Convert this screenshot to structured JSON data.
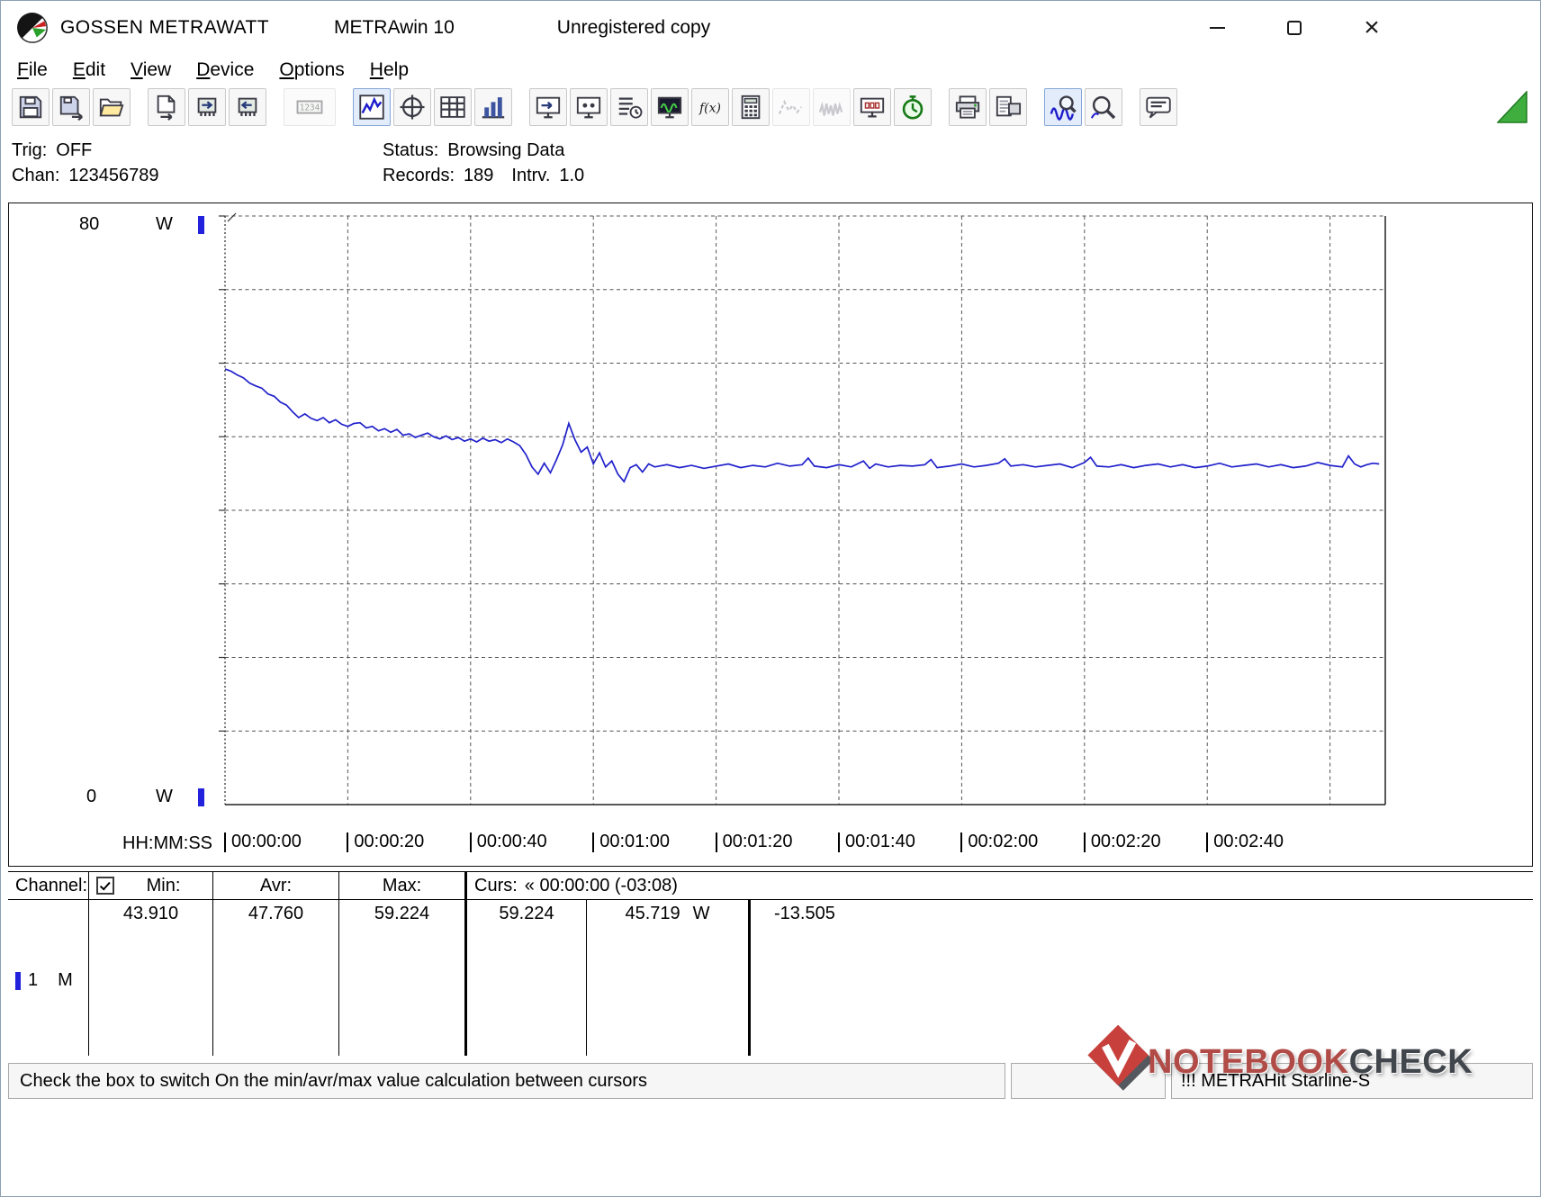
{
  "window": {
    "title_brand": "GOSSEN METRAWATT",
    "title_app": "METRAwin 10",
    "title_status": "Unregistered copy"
  },
  "menu": {
    "items": [
      "File",
      "Edit",
      "View",
      "Device",
      "Options",
      "Help"
    ]
  },
  "toolbar": {
    "groups": [
      [
        {
          "name": "save-button",
          "icon": "floppy-icon"
        },
        {
          "name": "export-save-button",
          "icon": "floppy-export-icon"
        },
        {
          "name": "open-button",
          "icon": "folder-open-icon"
        }
      ],
      [
        {
          "name": "export-file-button",
          "icon": "page-export-icon"
        },
        {
          "name": "read-device-button",
          "icon": "chip-in-icon"
        },
        {
          "name": "write-device-button",
          "icon": "chip-out-icon"
        }
      ],
      [
        {
          "name": "numeric-display-button",
          "icon": "lcd-icon",
          "icon_label": "1234",
          "wide": true,
          "state": "disabled"
        }
      ],
      [
        {
          "name": "trend-view-button",
          "icon": "trend-icon",
          "state": "active"
        },
        {
          "name": "xy-view-button",
          "icon": "crosshair-icon"
        },
        {
          "name": "table-view-button",
          "icon": "table-icon"
        },
        {
          "name": "bar-view-button",
          "icon": "bars-icon"
        }
      ],
      [
        {
          "name": "transfer-button",
          "icon": "monitor-arrow-icon"
        },
        {
          "name": "device-config-button",
          "icon": "monitor-config-icon"
        },
        {
          "name": "schedule-button",
          "icon": "list-clock-icon"
        },
        {
          "name": "monitor-button",
          "icon": "monitor-wave-icon"
        },
        {
          "name": "formula-button",
          "icon": "fx-icon",
          "icon_label": "f(x)"
        },
        {
          "name": "calculator-button",
          "icon": "calc-icon"
        },
        {
          "name": "signal-sparse-button",
          "icon": "wave-sparse-icon",
          "state": "disabled"
        },
        {
          "name": "signal-dense-button",
          "icon": "wave-dense-icon",
          "state": "disabled"
        },
        {
          "name": "meter-display-button",
          "icon": "meter-icon"
        },
        {
          "name": "timer-button",
          "icon": "timer-icon"
        }
      ],
      [
        {
          "name": "print-button",
          "icon": "printer-icon"
        },
        {
          "name": "print-preview-button",
          "icon": "printer-preview-icon"
        }
      ],
      [
        {
          "name": "zoom-curve-button",
          "icon": "zoom-wave-icon",
          "state": "active"
        },
        {
          "name": "zoom-button",
          "icon": "zoom-icon"
        }
      ],
      [
        {
          "name": "note-button",
          "icon": "note-icon"
        }
      ]
    ]
  },
  "info": {
    "trig_label": "Trig:",
    "trig": "OFF",
    "chan_label": "Chan:",
    "chan": "123456789",
    "status_label": "Status:",
    "status": "Browsing Data",
    "records_label": "Records:",
    "records": "189",
    "interval_label": "Intrv.",
    "interval": "1.0"
  },
  "chart_data": {
    "type": "line",
    "title": "",
    "y_max_label": "80",
    "y_min_label": "0",
    "y_axis_unit": "W",
    "ylim": [
      0,
      80
    ],
    "y_gridline_step": 10,
    "x_axis_label": "HH:MM:SS",
    "x_ticks": [
      "00:00:00",
      "00:00:20",
      "00:00:40",
      "00:01:00",
      "00:01:20",
      "00:01:40",
      "00:02:00",
      "00:02:20",
      "00:02:40"
    ],
    "x_tick_interval_s": 20,
    "xlim_s": [
      0,
      189
    ],
    "grid": "dashed",
    "series": [
      {
        "name": "Channel 1 power (W)",
        "color": "#2121cc",
        "points": [
          [
            0,
            59.2
          ],
          [
            1,
            58.9
          ],
          [
            2,
            58.4
          ],
          [
            3,
            58.0
          ],
          [
            4,
            57.3
          ],
          [
            5,
            56.9
          ],
          [
            6,
            56.6
          ],
          [
            7,
            55.8
          ],
          [
            8,
            55.5
          ],
          [
            9,
            54.7
          ],
          [
            10,
            54.3
          ],
          [
            11,
            53.4
          ],
          [
            12,
            52.6
          ],
          [
            13,
            53.1
          ],
          [
            14,
            52.5
          ],
          [
            15,
            52.2
          ],
          [
            16,
            52.6
          ],
          [
            17,
            51.9
          ],
          [
            18,
            52.3
          ],
          [
            19,
            51.7
          ],
          [
            20,
            51.4
          ],
          [
            21,
            51.8
          ],
          [
            22,
            51.9
          ],
          [
            23,
            51.2
          ],
          [
            24,
            51.4
          ],
          [
            25,
            50.8
          ],
          [
            26,
            51.1
          ],
          [
            27,
            50.6
          ],
          [
            28,
            51.0
          ],
          [
            29,
            50.2
          ],
          [
            30,
            50.4
          ],
          [
            31,
            49.9
          ],
          [
            32,
            50.2
          ],
          [
            33,
            50.5
          ],
          [
            34,
            50.0
          ],
          [
            35,
            49.7
          ],
          [
            36,
            50.1
          ],
          [
            37,
            49.6
          ],
          [
            38,
            49.9
          ],
          [
            39,
            49.4
          ],
          [
            40,
            49.7
          ],
          [
            41,
            49.3
          ],
          [
            42,
            49.8
          ],
          [
            43,
            49.4
          ],
          [
            44,
            49.6
          ],
          [
            45,
            49.2
          ],
          [
            46,
            49.7
          ],
          [
            47,
            49.3
          ],
          [
            48,
            48.8
          ],
          [
            49,
            47.6
          ],
          [
            50,
            45.9
          ],
          [
            51,
            44.9
          ],
          [
            52,
            46.4
          ],
          [
            53,
            45.1
          ],
          [
            54,
            46.9
          ],
          [
            55,
            48.9
          ],
          [
            56,
            51.8
          ],
          [
            57,
            49.6
          ],
          [
            58,
            47.9
          ],
          [
            59,
            48.6
          ],
          [
            60,
            46.3
          ],
          [
            61,
            47.8
          ],
          [
            62,
            45.9
          ],
          [
            63,
            46.7
          ],
          [
            64,
            44.9
          ],
          [
            65,
            43.9
          ],
          [
            66,
            45.8
          ],
          [
            67,
            46.2
          ],
          [
            68,
            45.2
          ],
          [
            69,
            46.3
          ],
          [
            70,
            45.9
          ],
          [
            72,
            46.2
          ],
          [
            74,
            45.8
          ],
          [
            76,
            46.1
          ],
          [
            78,
            45.7
          ],
          [
            80,
            46.0
          ],
          [
            82,
            46.3
          ],
          [
            84,
            45.8
          ],
          [
            86,
            46.1
          ],
          [
            88,
            45.9
          ],
          [
            90,
            46.4
          ],
          [
            92,
            46.0
          ],
          [
            94,
            46.2
          ],
          [
            95,
            47.1
          ],
          [
            96,
            46.0
          ],
          [
            98,
            45.8
          ],
          [
            100,
            46.2
          ],
          [
            102,
            45.9
          ],
          [
            104,
            46.7
          ],
          [
            105,
            45.7
          ],
          [
            106,
            46.3
          ],
          [
            108,
            45.9
          ],
          [
            110,
            46.1
          ],
          [
            112,
            46.0
          ],
          [
            114,
            46.2
          ],
          [
            115,
            46.9
          ],
          [
            116,
            45.8
          ],
          [
            118,
            46.0
          ],
          [
            120,
            46.3
          ],
          [
            122,
            45.9
          ],
          [
            124,
            46.1
          ],
          [
            126,
            46.4
          ],
          [
            127,
            47.0
          ],
          [
            128,
            46.0
          ],
          [
            130,
            46.2
          ],
          [
            132,
            45.9
          ],
          [
            134,
            46.1
          ],
          [
            136,
            46.3
          ],
          [
            138,
            45.8
          ],
          [
            140,
            46.5
          ],
          [
            141,
            47.2
          ],
          [
            142,
            46.0
          ],
          [
            144,
            45.9
          ],
          [
            146,
            46.2
          ],
          [
            148,
            45.8
          ],
          [
            150,
            46.1
          ],
          [
            152,
            46.3
          ],
          [
            154,
            45.9
          ],
          [
            156,
            46.2
          ],
          [
            158,
            45.8
          ],
          [
            160,
            46.0
          ],
          [
            162,
            46.4
          ],
          [
            164,
            45.9
          ],
          [
            166,
            46.1
          ],
          [
            168,
            46.3
          ],
          [
            170,
            45.9
          ],
          [
            172,
            46.2
          ],
          [
            174,
            45.8
          ],
          [
            176,
            46.0
          ],
          [
            178,
            46.5
          ],
          [
            180,
            46.1
          ],
          [
            182,
            45.9
          ],
          [
            183,
            47.4
          ],
          [
            184,
            46.3
          ],
          [
            185,
            45.9
          ],
          [
            186,
            46.2
          ],
          [
            187,
            46.4
          ],
          [
            188,
            46.3
          ]
        ]
      }
    ]
  },
  "table": {
    "header": {
      "channel": "Channel:",
      "checkbox_checked": true,
      "min": "Min:",
      "avr": "Avr:",
      "max": "Max:",
      "curs_label": "Curs:",
      "curs_value": "« 00:00:00 (-03:08)"
    },
    "rows": [
      {
        "channel": "1",
        "mode": "M",
        "min": "43.910",
        "avr": "47.760",
        "max": "59.224",
        "curs_a": "59.224",
        "curs_b": "45.719",
        "curs_b_unit": "W",
        "delta": "-13.505"
      }
    ]
  },
  "statusbar": {
    "hint": "Check the box to switch On the min/avr/max value calculation between cursors",
    "device": "!!! METRAHit Starline-S"
  },
  "watermark": {
    "brand_1": "NOTEBOOK",
    "brand_2": "CHECK",
    "color_1": "#b14b47",
    "color_2": "#41454c"
  },
  "colors": {
    "trace": "#2121cc",
    "cursor_marker": "#2222dd",
    "timer_green": "#177a17"
  }
}
